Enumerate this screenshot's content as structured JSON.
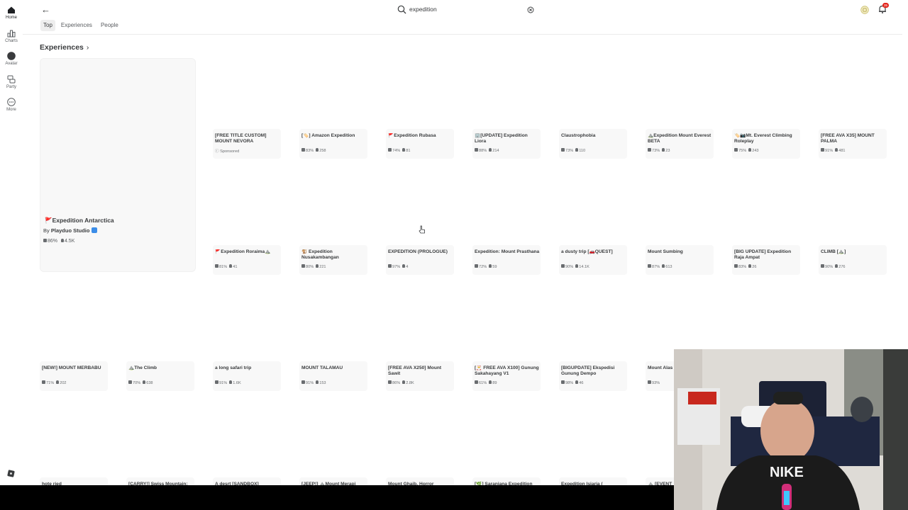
{
  "rail": [
    {
      "label": "Home",
      "icon": "home-icon",
      "active": true
    },
    {
      "label": "Charts",
      "icon": "charts-icon",
      "active": false
    },
    {
      "label": "Avatar",
      "icon": "avatar-icon",
      "active": false
    },
    {
      "label": "Party",
      "icon": "party-icon",
      "active": false
    },
    {
      "label": "More",
      "icon": "more-icon",
      "active": false
    }
  ],
  "search": {
    "query": "expedition"
  },
  "notifications": {
    "badge": "35"
  },
  "tabs": [
    "Top",
    "Experiences",
    "People"
  ],
  "section": {
    "title": "Experiences"
  },
  "featured": {
    "title": "🚩Expedition Antarctica",
    "by_prefix": "By",
    "creator": "Playduo Studio",
    "rating": "86%",
    "players": "4.5K"
  },
  "rows": [
    [
      {
        "title": "[FREE TITLE CUSTOM] MOUNT NEVORA",
        "sponsored": "Sponsored"
      },
      {
        "title": "[🏷️] Amazon Expedition",
        "rating": "83%",
        "players": "258"
      },
      {
        "title": "🚩Expedition Rubasa",
        "rating": "74%",
        "players": "81"
      },
      {
        "title": "🏢[UPDATE] Expedition Liora",
        "rating": "88%",
        "players": "214"
      },
      {
        "title": "Claustrophobia",
        "rating": "73%",
        "players": "110"
      },
      {
        "title": "⛰️Expedition Mount Everest BETA",
        "rating": "73%",
        "players": "23"
      },
      {
        "title": "🏷️📷Mt. Everest Climbing Roleplay",
        "rating": "75%",
        "players": "243"
      },
      {
        "title": "[FREE AVA X35] MOUNT PALMA",
        "rating": "91%",
        "players": "481"
      }
    ],
    [
      {
        "title": "🚩Expedition Roraima⛰️",
        "rating": "81%",
        "players": "41"
      },
      {
        "title": "🐒 Expedition Nusakambangan",
        "rating": "80%",
        "players": "221"
      },
      {
        "title": "EXPEDITION (PROLOGUE)",
        "rating": "97%",
        "players": "4"
      },
      {
        "title": "Expedition: Mount Prasthana",
        "rating": "72%",
        "players": "59"
      },
      {
        "title": "a dusty trip [🚗QUEST]",
        "rating": "90%",
        "players": "14.1K"
      },
      {
        "title": "Mount Sumbing",
        "rating": "87%",
        "players": "613"
      },
      {
        "title": "[BIG UPDATE] Expedition Raja Ampat",
        "rating": "83%",
        "players": "26"
      },
      {
        "title": "CLIMB [⛰️]",
        "rating": "90%",
        "players": "276"
      }
    ],
    [
      {
        "title": "[NEW!] MOUNT MERBABU",
        "rating": "71%",
        "players": "202"
      },
      {
        "title": "⛰️The Climb",
        "rating": "70%",
        "players": "638"
      },
      {
        "title": "a long safari trip",
        "rating": "91%",
        "players": "1.6K"
      },
      {
        "title": "MOUNT TALAMAU",
        "rating": "91%",
        "players": "153"
      },
      {
        "title": "[FREE AVA X250] Mount Sawit",
        "rating": "86%",
        "players": "2.8K"
      },
      {
        "title": "[🎅 FREE AVA X100] Gunung Sakahayang V1",
        "rating": "61%",
        "players": "89"
      },
      {
        "title": "[BIGUPDATE] Ekspedisi Gunung Dempo",
        "rating": "98%",
        "players": "46"
      },
      {
        "title": "Mount Alas TESTING]",
        "rating": "93%",
        "players": ""
      }
    ],
    [
      {
        "title": "hote ried"
      },
      {
        "title": "[CARRY!] Swiss Mountain:"
      },
      {
        "title": "A desrt [SANDBOX]"
      },
      {
        "title": "[JEEP!] ⛰️Mount Merapi"
      },
      {
        "title": "Mount Ghaib, Horror"
      },
      {
        "title": "[🌿] Saranjana Expedition"
      },
      {
        "title": "Expedition Isiaria ("
      },
      {
        "title": "⛰️ [EVENT"
      }
    ]
  ]
}
